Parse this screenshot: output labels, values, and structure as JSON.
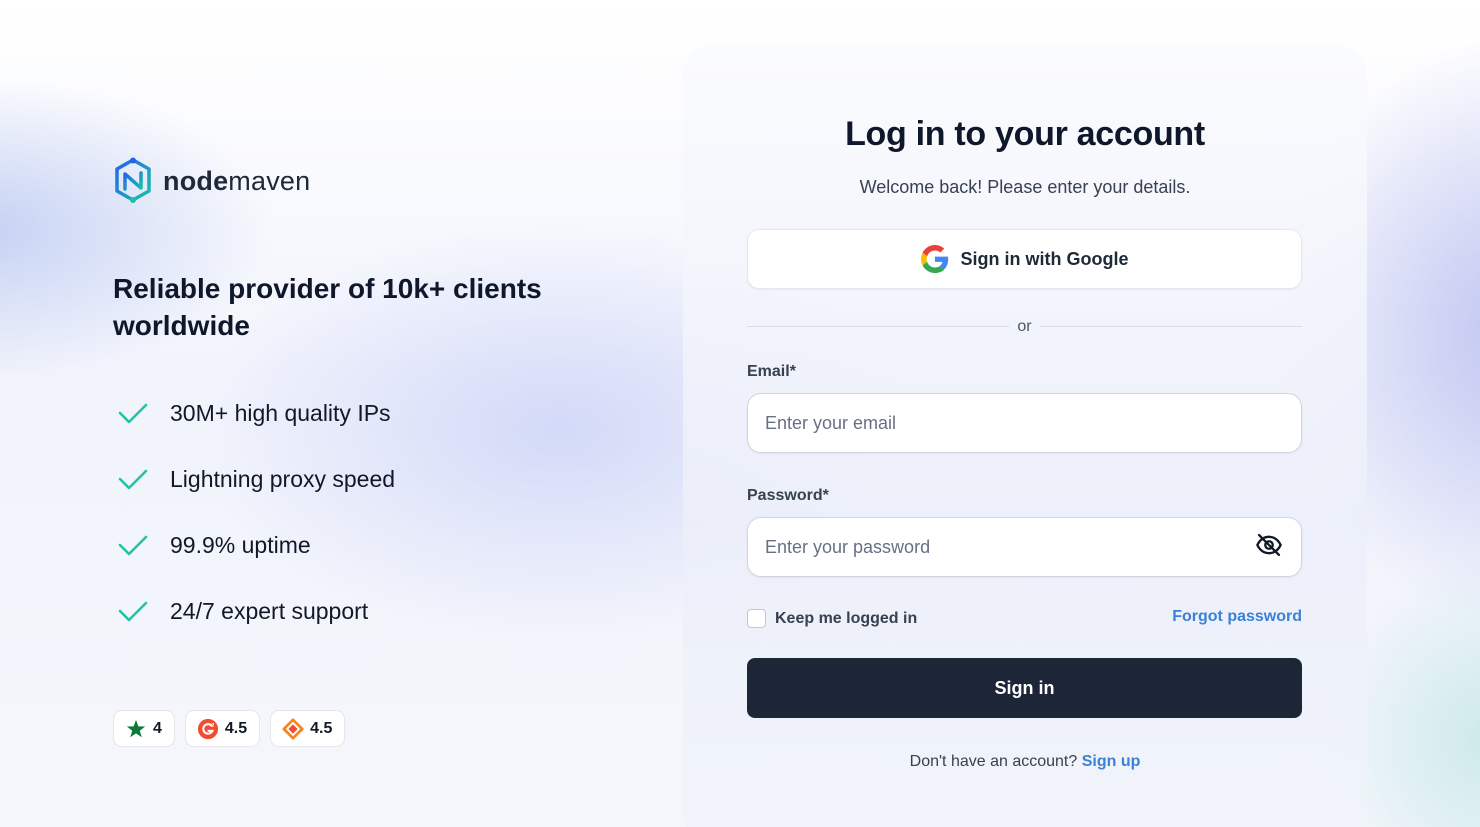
{
  "brand": {
    "name_bold": "node",
    "name_regular": "maven",
    "logo_icon": "nodemaven-logo-icon",
    "colors": {
      "logo_teal": "#1ab5b5",
      "logo_blue": "#2563eb",
      "check_green": "#22c3a6"
    }
  },
  "left": {
    "tagline": "Reliable provider of 10k+ clients worldwide",
    "features": [
      {
        "label": "30M+ high quality IPs",
        "icon": "check-icon"
      },
      {
        "label": "Lightning proxy speed",
        "icon": "check-icon"
      },
      {
        "label": "99.9% uptime",
        "icon": "check-icon"
      },
      {
        "label": "24/7 expert support",
        "icon": "check-icon"
      }
    ],
    "ratings": [
      {
        "value": "4",
        "icon": "trustpilot-star-icon",
        "color": "#0e7a3a"
      },
      {
        "value": "4.5",
        "icon": "g2-icon",
        "color": "#f04e32"
      },
      {
        "value": "4.5",
        "icon": "capterra-icon",
        "color": "#f7861f"
      }
    ]
  },
  "login": {
    "title": "Log in to your account",
    "subtitle": "Welcome back! Please enter your details.",
    "google_button": "Sign in with Google",
    "divider": "or",
    "email_label": "Email*",
    "email_placeholder": "Enter your email",
    "email_value": "",
    "password_label": "Password*",
    "password_placeholder": "Enter your password",
    "password_value": "",
    "password_toggle_icon": "eye-off-icon",
    "keep_logged_in": "Keep me logged in",
    "keep_logged_in_checked": false,
    "forgot_password": "Forgot password",
    "signin_button": "Sign in",
    "signup_prompt": "Don't have an account?",
    "signup_link": "Sign up",
    "colors": {
      "primary_button": "#1d2636",
      "link": "#3b82d6"
    }
  }
}
